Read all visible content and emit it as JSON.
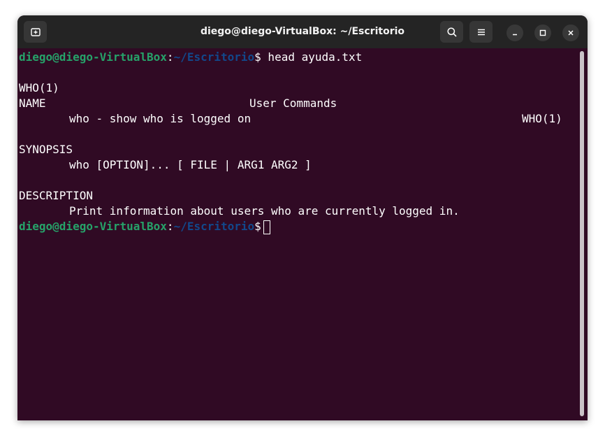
{
  "window": {
    "title": "diego@diego-VirtualBox: ~/Escritorio"
  },
  "icons": {
    "new_tab": "new-tab-icon",
    "search": "search-icon",
    "menu": "hamburger-menu-icon",
    "minimize": "minimize-icon",
    "maximize": "maximize-icon",
    "close": "close-icon"
  },
  "colors": {
    "terminal_bg": "#300a24",
    "titlebar_bg": "#242424",
    "prompt_user": "#26a269",
    "prompt_path": "#12488b",
    "text": "#ffffff"
  },
  "terminal": {
    "prompt1": {
      "user_host": "diego@diego-VirtualBox",
      "sep": ":",
      "path": "~/Escritorio",
      "symbol": "$",
      "command": " head ayuda.txt"
    },
    "header": {
      "left": "WHO(1)",
      "center": "User Commands",
      "right": "WHO(1)"
    },
    "sections": {
      "name_heading": "NAME",
      "name_text": "who - show who is logged on",
      "synopsis_heading": "SYNOPSIS",
      "synopsis_text": "who [OPTION]... [ FILE | ARG1 ARG2 ]",
      "description_heading": "DESCRIPTION",
      "description_text": "Print information about users who are currently logged in."
    },
    "prompt2": {
      "user_host": "diego@diego-VirtualBox",
      "sep": ":",
      "path": "~/Escritorio",
      "symbol": "$"
    }
  }
}
